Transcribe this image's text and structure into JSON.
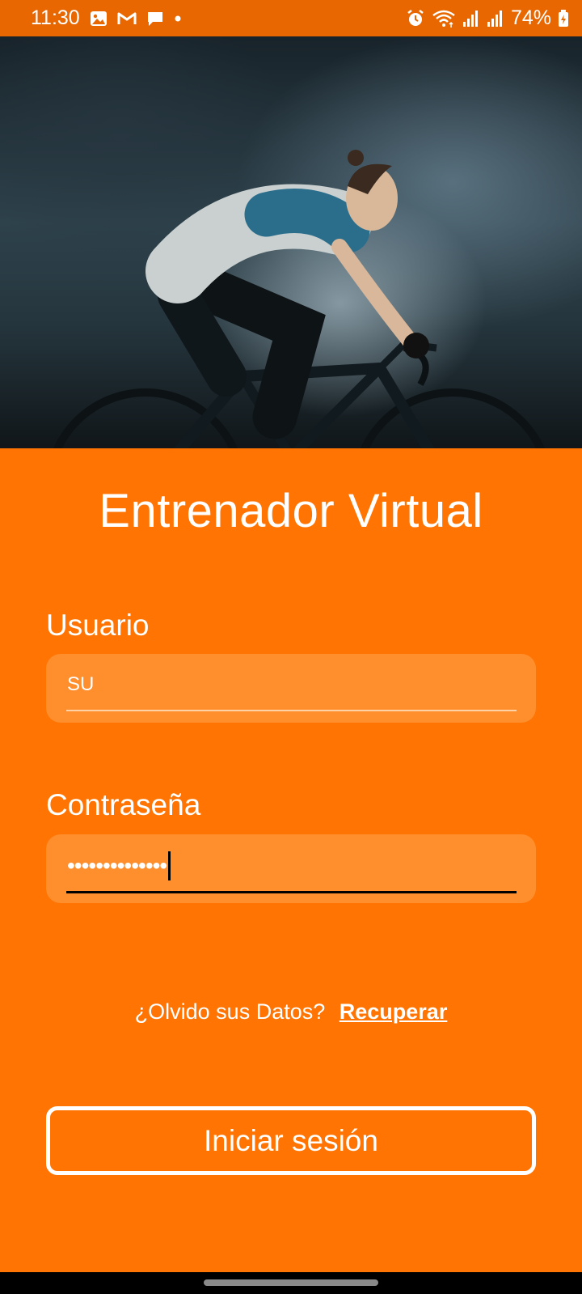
{
  "status_bar": {
    "time": "11:30",
    "left_icons": [
      "gallery-icon",
      "gmail-icon",
      "message-icon",
      "dot-icon"
    ],
    "right_icons": [
      "alarm-icon",
      "wifi-icon",
      "signal-icon",
      "signal-icon"
    ],
    "battery": "74%"
  },
  "hero": {
    "image_icon": "cyclist-photo"
  },
  "app": {
    "title": "Entrenador Virtual"
  },
  "form": {
    "username_label": "Usuario",
    "username_value": "SU",
    "password_label": "Contraseña",
    "password_masked": "••••••••••••••"
  },
  "forgot": {
    "text": "¿Olvido sus Datos?",
    "link": "Recuperar"
  },
  "login": {
    "button_label": "Iniciar sesión"
  },
  "colors": {
    "accent": "#FF7402",
    "status_bar": "#E86700",
    "input_bg": "#FF8E2D"
  }
}
